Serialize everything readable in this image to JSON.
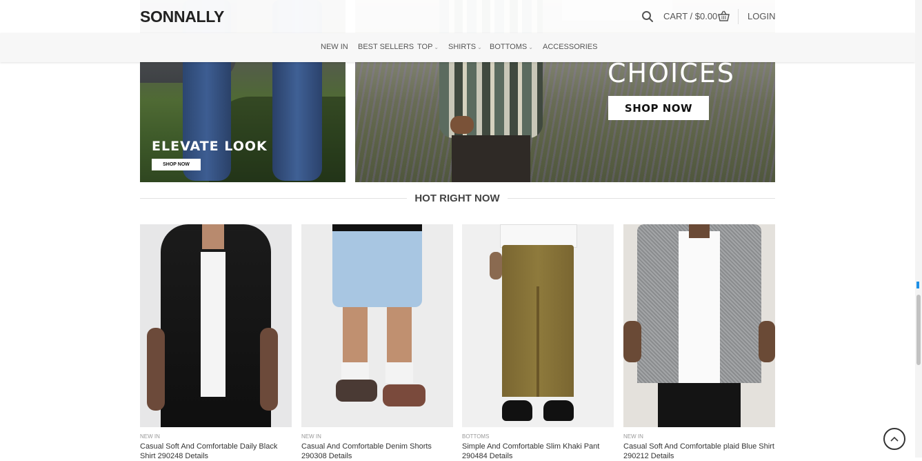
{
  "header": {
    "logo": "SONNALLY",
    "cart_label": "CART / $0.00",
    "login_label": "LOGIN",
    "search_icon": "search-icon",
    "cart_icon": "basket-icon"
  },
  "nav": {
    "items": [
      {
        "label": "NEW IN",
        "dropdown": false
      },
      {
        "label": "BEST SELLERS",
        "dropdown": false
      },
      {
        "label": "TOP",
        "dropdown": true
      },
      {
        "label": "SHIRTS",
        "dropdown": true
      },
      {
        "label": "BOTTOMS",
        "dropdown": true
      },
      {
        "label": "ACCESSORIES",
        "dropdown": false
      }
    ]
  },
  "banners": {
    "left": {
      "title": "ELEVATE LOOK",
      "button": "SHOP NOW"
    },
    "right": {
      "title": "CHOICES",
      "button": "SHOP NOW"
    }
  },
  "section": {
    "title": "HOT RIGHT NOW"
  },
  "products": [
    {
      "category": "NEW IN",
      "name": "Casual Soft And Comfortable Daily Black Shirt 290248 Details"
    },
    {
      "category": "NEW IN",
      "name": "Casual And Comfortable Denim Shorts 290308 Details"
    },
    {
      "category": "BOTTOMS",
      "name": "Simple And Comfortable Slim Khaki Pant 290484 Details"
    },
    {
      "category": "NEW IN",
      "name": "Casual Soft And Comfortable plaid Blue Shirt 290212 Details"
    }
  ],
  "colors": {
    "accent": "#1e90e6",
    "text": "#333333"
  }
}
